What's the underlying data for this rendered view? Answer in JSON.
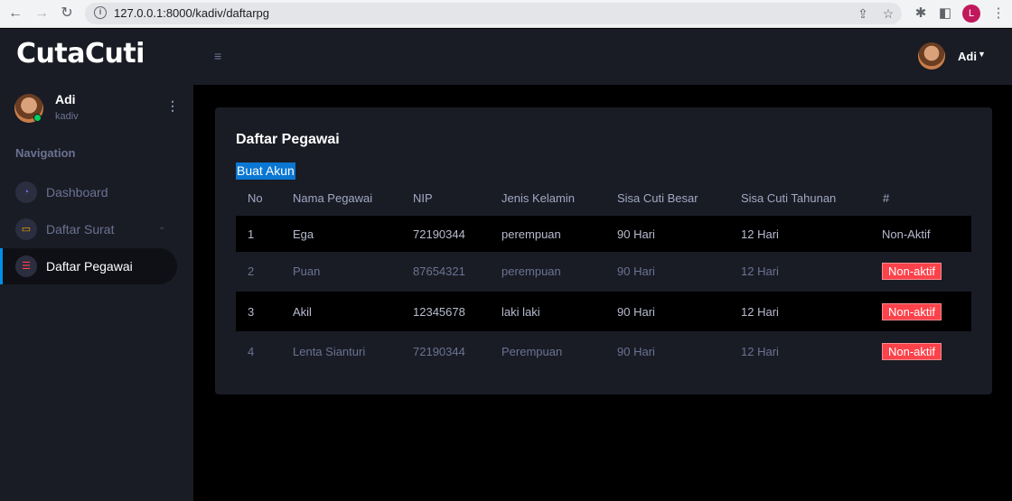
{
  "browser": {
    "url": "127.0.0.1:8000/kadiv/daftarpg",
    "profile_initial": "L"
  },
  "app": {
    "brand": "CutaCuti",
    "top_user": "Adi"
  },
  "sidebar": {
    "user_name": "Adi",
    "user_role": "kadiv",
    "nav_heading": "Navigation",
    "items": [
      {
        "label": "Dashboard",
        "icon": "speedometer-icon",
        "icon_color": "#8f5fe8"
      },
      {
        "label": "Daftar Surat",
        "icon": "laptop-icon",
        "icon_color": "#ffab00"
      },
      {
        "label": "Daftar Pegawai",
        "icon": "list-icon",
        "icon_color": "#fc424a"
      }
    ]
  },
  "card": {
    "title": "Daftar Pegawai",
    "create_link": "Buat Akun"
  },
  "table": {
    "headers": [
      "No",
      "Nama Pegawai",
      "NIP",
      "Jenis Kelamin",
      "Sisa Cuti Besar",
      "Sisa Cuti Tahunan",
      "#"
    ],
    "rows": [
      {
        "no": "1",
        "nama": "Ega",
        "nip": "72190344",
        "jk": "perempuan",
        "besar": "90 Hari",
        "tahunan": "12 Hari",
        "status": "Non-Aktif"
      },
      {
        "no": "2",
        "nama": "Puan",
        "nip": "87654321",
        "jk": "perempuan",
        "besar": "90 Hari",
        "tahunan": "12 Hari",
        "status": "Non-aktif"
      },
      {
        "no": "3",
        "nama": "Akil",
        "nip": "12345678",
        "jk": "laki laki",
        "besar": "90 Hari",
        "tahunan": "12 Hari",
        "status": "Non-aktif"
      },
      {
        "no": "4",
        "nama": "Lenta Sianturi",
        "nip": "72190344",
        "jk": "Perempuan",
        "besar": "90 Hari",
        "tahunan": "12 Hari",
        "status": "Non-aktif"
      }
    ]
  },
  "colors": {
    "accent": "#0090e7",
    "badge": "#fc424a",
    "online": "#00d25b"
  }
}
